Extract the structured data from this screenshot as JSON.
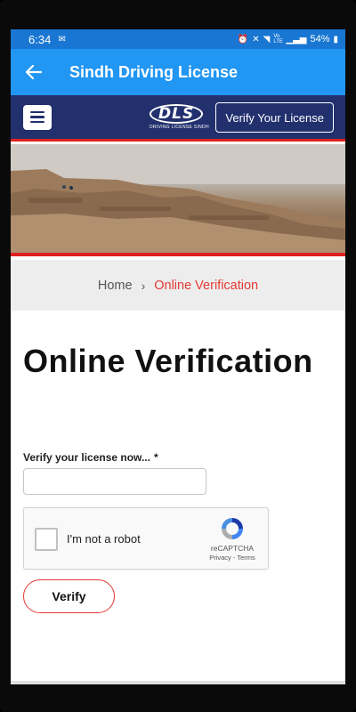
{
  "statusbar": {
    "time": "6:34",
    "battery": "54%",
    "signal_text": "Vo LTE"
  },
  "appbar": {
    "title": "Sindh Driving License"
  },
  "navbar": {
    "verify_label": "Verify Your License",
    "logo_text": "DLS",
    "logo_subtext": "DRIVING LICENSE SINDH"
  },
  "breadcrumb": {
    "home": "Home",
    "separator": "›",
    "current": "Online Verification"
  },
  "page": {
    "title": "Online Verification"
  },
  "form": {
    "label": "Verify your license now...",
    "required_mark": "*",
    "input_value": "",
    "input_placeholder": "",
    "captcha_label": "I'm not a robot",
    "captcha_brand": "reCAPTCHA",
    "captcha_links": "Privacy - Terms",
    "submit_label": "Verify"
  },
  "colors": {
    "appbar": "#2196f3",
    "statusbar": "#1976d2",
    "navbar": "#22306e",
    "accent_red": "#e53935"
  }
}
